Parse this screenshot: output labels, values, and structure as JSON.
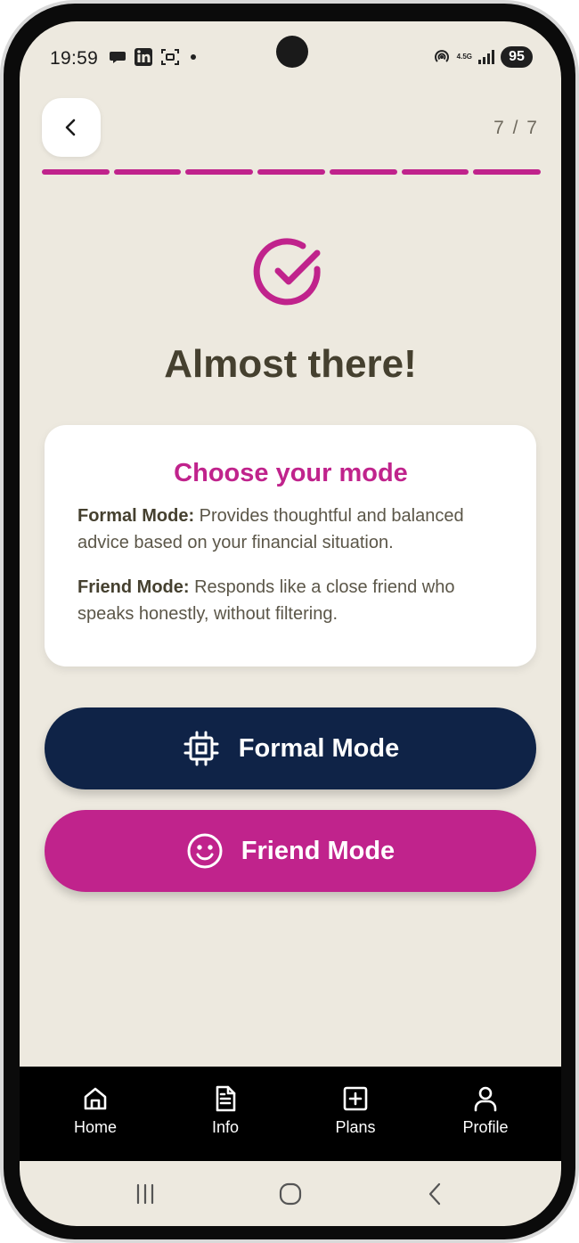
{
  "status_bar": {
    "time": "19:59",
    "network": "4.5G",
    "battery": "95"
  },
  "header": {
    "step": "7 / 7",
    "progress_total": 7,
    "progress_done": 7
  },
  "main": {
    "title": "Almost there!",
    "card": {
      "title": "Choose your mode",
      "formal_label": "Formal Mode:",
      "formal_desc": " Provides thoughtful and balanced advice based on your financial situation.",
      "friend_label": "Friend Mode:",
      "friend_desc": " Responds like a close friend who speaks honestly, without filtering."
    },
    "buttons": {
      "formal": "Formal Mode",
      "friend": "Friend Mode"
    }
  },
  "bottom_nav": {
    "items": [
      {
        "label": "Home",
        "icon": "home-icon"
      },
      {
        "label": "Info",
        "icon": "document-icon"
      },
      {
        "label": "Plans",
        "icon": "plus-square-icon"
      },
      {
        "label": "Profile",
        "icon": "user-icon"
      }
    ]
  },
  "colors": {
    "accent": "#c0238c",
    "navy": "#0f2347",
    "background": "#ede9df",
    "text_dark": "#45402f"
  }
}
